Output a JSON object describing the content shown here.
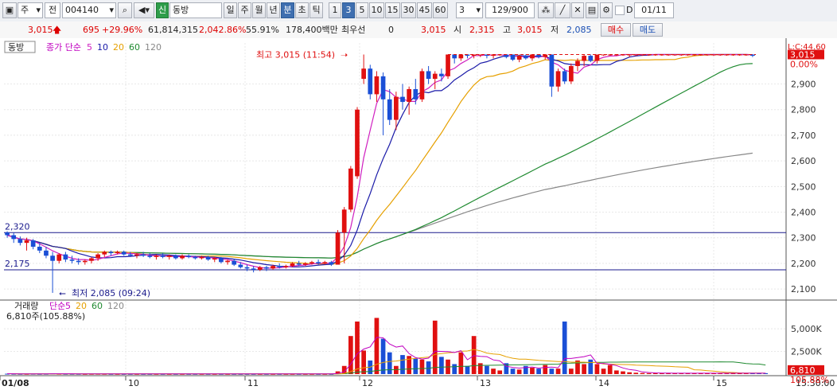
{
  "toolbar": {
    "type_select": "주",
    "type_select2": "전",
    "code": "004140",
    "stock_badge": "신",
    "stock_name": "동방",
    "periods": [
      "일",
      "주",
      "월",
      "년",
      "분",
      "초",
      "틱"
    ],
    "active_period": "분",
    "minutes": [
      "1",
      "3",
      "5",
      "10",
      "15",
      "30",
      "45",
      "60"
    ],
    "active_minute": "3",
    "interval_value": "3",
    "count": "129/900",
    "date_checkbox": "D",
    "date": "01/11"
  },
  "quote": {
    "price": "3,015",
    "change": "695",
    "change_pct": "+29.96%",
    "volume": "61,814,315",
    "vol_ratio": "2,042.86%",
    "turnover": "55.91%",
    "amount": "178,400백만",
    "pref_label": "최우선",
    "pref_value": "0",
    "ask": "3,015",
    "open_label": "시",
    "open": "2,315",
    "high_label": "고",
    "high": "3,015",
    "low_label": "저",
    "low": "2,085",
    "buy_label": "매수",
    "sell_label": "매도"
  },
  "price_panel": {
    "stock_label": "동방",
    "legend": [
      {
        "label": "종가 단순",
        "color": "#c000c0"
      },
      {
        "label": "5",
        "color": "#d020c0"
      },
      {
        "label": "10",
        "color": "#1a1aa8"
      },
      {
        "label": "20",
        "color": "#e6a000"
      },
      {
        "label": "60",
        "color": "#1f8a30"
      },
      {
        "label": "120",
        "color": "#888888"
      }
    ],
    "high_annotation": "최고 3,015 (11:54)",
    "low_annotation": "최저 2,085 (09:24)",
    "line1_label": "2,320",
    "line2_label": "2,175",
    "axis_top_label": "L:C:44.60",
    "price_badge": "3,015",
    "pct_badge": "0.00%",
    "y_ticks": [
      "2,900",
      "2,800",
      "2,700",
      "2,600",
      "2,500",
      "2,400",
      "2,300",
      "2,200",
      "2,100"
    ]
  },
  "volume_panel": {
    "title": "거래량",
    "legend": [
      {
        "label": "단순",
        "color": "#c000c0"
      },
      {
        "label": "5",
        "color": "#c000c0"
      },
      {
        "label": "20",
        "color": "#e6a000"
      },
      {
        "label": "60",
        "color": "#1f8a30"
      },
      {
        "label": "120",
        "color": "#888888"
      }
    ],
    "current": "6,810주(105.88%)",
    "y_ticks": [
      "5,000K",
      "2,500K"
    ],
    "vol_badge": "6,810",
    "vol_pct": "105.88%"
  },
  "x_axis": {
    "labels": [
      "01/08",
      "10",
      "11",
      "12",
      "13",
      "14",
      "15"
    ],
    "time": "15:30:00"
  },
  "chart_data": {
    "type": "candlestick",
    "y_range": [
      2060,
      3060
    ],
    "candles": [
      {
        "o": 2320,
        "h": 2325,
        "l": 2300,
        "c": 2310
      },
      {
        "o": 2310,
        "h": 2320,
        "l": 2280,
        "c": 2295
      },
      {
        "o": 2295,
        "h": 2305,
        "l": 2270,
        "c": 2280
      },
      {
        "o": 2280,
        "h": 2300,
        "l": 2250,
        "c": 2290
      },
      {
        "o": 2290,
        "h": 2295,
        "l": 2255,
        "c": 2265
      },
      {
        "o": 2265,
        "h": 2280,
        "l": 2240,
        "c": 2250
      },
      {
        "o": 2250,
        "h": 2265,
        "l": 2220,
        "c": 2230
      },
      {
        "o": 2230,
        "h": 2245,
        "l": 2085,
        "c": 2210
      },
      {
        "o": 2210,
        "h": 2240,
        "l": 2200,
        "c": 2235
      },
      {
        "o": 2235,
        "h": 2245,
        "l": 2205,
        "c": 2215
      },
      {
        "o": 2215,
        "h": 2230,
        "l": 2200,
        "c": 2210
      },
      {
        "o": 2210,
        "h": 2220,
        "l": 2195,
        "c": 2205
      },
      {
        "o": 2205,
        "h": 2215,
        "l": 2195,
        "c": 2210
      },
      {
        "o": 2210,
        "h": 2225,
        "l": 2200,
        "c": 2220
      },
      {
        "o": 2220,
        "h": 2240,
        "l": 2210,
        "c": 2235
      },
      {
        "o": 2235,
        "h": 2250,
        "l": 2225,
        "c": 2245
      },
      {
        "o": 2245,
        "h": 2250,
        "l": 2230,
        "c": 2240
      },
      {
        "o": 2240,
        "h": 2250,
        "l": 2235,
        "c": 2245
      },
      {
        "o": 2245,
        "h": 2250,
        "l": 2230,
        "c": 2235
      },
      {
        "o": 2235,
        "h": 2245,
        "l": 2225,
        "c": 2230
      },
      {
        "o": 2230,
        "h": 2240,
        "l": 2220,
        "c": 2235
      },
      {
        "o": 2235,
        "h": 2245,
        "l": 2225,
        "c": 2230
      },
      {
        "o": 2230,
        "h": 2240,
        "l": 2220,
        "c": 2225
      },
      {
        "o": 2225,
        "h": 2235,
        "l": 2215,
        "c": 2230
      },
      {
        "o": 2230,
        "h": 2240,
        "l": 2220,
        "c": 2225
      },
      {
        "o": 2225,
        "h": 2235,
        "l": 2215,
        "c": 2230
      },
      {
        "o": 2230,
        "h": 2235,
        "l": 2215,
        "c": 2220
      },
      {
        "o": 2220,
        "h": 2235,
        "l": 2215,
        "c": 2230
      },
      {
        "o": 2230,
        "h": 2235,
        "l": 2220,
        "c": 2225
      },
      {
        "o": 2225,
        "h": 2230,
        "l": 2215,
        "c": 2220
      },
      {
        "o": 2220,
        "h": 2230,
        "l": 2215,
        "c": 2225
      },
      {
        "o": 2225,
        "h": 2230,
        "l": 2210,
        "c": 2215
      },
      {
        "o": 2215,
        "h": 2225,
        "l": 2205,
        "c": 2220
      },
      {
        "o": 2220,
        "h": 2225,
        "l": 2200,
        "c": 2205
      },
      {
        "o": 2205,
        "h": 2215,
        "l": 2195,
        "c": 2210
      },
      {
        "o": 2210,
        "h": 2215,
        "l": 2190,
        "c": 2195
      },
      {
        "o": 2195,
        "h": 2205,
        "l": 2180,
        "c": 2185
      },
      {
        "o": 2185,
        "h": 2195,
        "l": 2170,
        "c": 2180
      },
      {
        "o": 2180,
        "h": 2190,
        "l": 2165,
        "c": 2175
      },
      {
        "o": 2175,
        "h": 2190,
        "l": 2170,
        "c": 2185
      },
      {
        "o": 2185,
        "h": 2190,
        "l": 2170,
        "c": 2180
      },
      {
        "o": 2180,
        "h": 2195,
        "l": 2175,
        "c": 2190
      },
      {
        "o": 2190,
        "h": 2200,
        "l": 2180,
        "c": 2185
      },
      {
        "o": 2185,
        "h": 2195,
        "l": 2180,
        "c": 2190
      },
      {
        "o": 2190,
        "h": 2205,
        "l": 2185,
        "c": 2200
      },
      {
        "o": 2200,
        "h": 2210,
        "l": 2190,
        "c": 2195
      },
      {
        "o": 2195,
        "h": 2205,
        "l": 2190,
        "c": 2200
      },
      {
        "o": 2200,
        "h": 2210,
        "l": 2195,
        "c": 2205
      },
      {
        "o": 2205,
        "h": 2215,
        "l": 2195,
        "c": 2200
      },
      {
        "o": 2200,
        "h": 2210,
        "l": 2195,
        "c": 2205
      },
      {
        "o": 2205,
        "h": 2210,
        "l": 2190,
        "c": 2195
      },
      {
        "o": 2195,
        "h": 2330,
        "l": 2195,
        "c": 2320
      },
      {
        "o": 2320,
        "h": 2420,
        "l": 2200,
        "c": 2410
      },
      {
        "o": 2410,
        "h": 2580,
        "l": 2400,
        "c": 2570
      },
      {
        "o": 2540,
        "h": 2810,
        "l": 2530,
        "c": 2800
      },
      {
        "o": 2920,
        "h": 3015,
        "l": 2900,
        "c": 2960
      },
      {
        "o": 2960,
        "h": 2975,
        "l": 2840,
        "c": 2860
      },
      {
        "o": 2860,
        "h": 2950,
        "l": 2830,
        "c": 2930
      },
      {
        "o": 2930,
        "h": 2945,
        "l": 2700,
        "c": 2840
      },
      {
        "o": 2840,
        "h": 2880,
        "l": 2740,
        "c": 2760
      },
      {
        "o": 2760,
        "h": 2870,
        "l": 2720,
        "c": 2850
      },
      {
        "o": 2850,
        "h": 2900,
        "l": 2800,
        "c": 2830
      },
      {
        "o": 2830,
        "h": 2890,
        "l": 2780,
        "c": 2880
      },
      {
        "o": 2880,
        "h": 2920,
        "l": 2820,
        "c": 2840
      },
      {
        "o": 2840,
        "h": 2960,
        "l": 2830,
        "c": 2950
      },
      {
        "o": 2950,
        "h": 2970,
        "l": 2900,
        "c": 2920
      },
      {
        "o": 2920,
        "h": 2950,
        "l": 2880,
        "c": 2940
      },
      {
        "o": 2940,
        "h": 2960,
        "l": 2910,
        "c": 2930
      },
      {
        "o": 2930,
        "h": 3015,
        "l": 2920,
        "c": 3015
      },
      {
        "o": 3015,
        "h": 3015,
        "l": 2980,
        "c": 3000
      },
      {
        "o": 3000,
        "h": 3015,
        "l": 2990,
        "c": 3015
      },
      {
        "o": 3015,
        "h": 3015,
        "l": 3000,
        "c": 3010
      },
      {
        "o": 3010,
        "h": 3015,
        "l": 3000,
        "c": 3015
      },
      {
        "o": 3015,
        "h": 3015,
        "l": 3005,
        "c": 3015
      },
      {
        "o": 3015,
        "h": 3015,
        "l": 3000,
        "c": 3010
      },
      {
        "o": 3010,
        "h": 3015,
        "l": 3000,
        "c": 3015
      },
      {
        "o": 3015,
        "h": 3015,
        "l": 3010,
        "c": 3015
      },
      {
        "o": 3015,
        "h": 3015,
        "l": 3000,
        "c": 3005
      },
      {
        "o": 3015,
        "h": 3015,
        "l": 2990,
        "c": 2995
      },
      {
        "o": 2995,
        "h": 3015,
        "l": 2985,
        "c": 3010
      },
      {
        "o": 3010,
        "h": 3015,
        "l": 2995,
        "c": 3000
      },
      {
        "o": 3000,
        "h": 3015,
        "l": 2990,
        "c": 3015
      },
      {
        "o": 3015,
        "h": 3015,
        "l": 3000,
        "c": 3005
      },
      {
        "o": 3005,
        "h": 3015,
        "l": 2995,
        "c": 3015
      },
      {
        "o": 3015,
        "h": 3015,
        "l": 2850,
        "c": 2890
      },
      {
        "o": 2890,
        "h": 2960,
        "l": 2870,
        "c": 2950
      },
      {
        "o": 2950,
        "h": 2960,
        "l": 2900,
        "c": 2910
      },
      {
        "o": 2910,
        "h": 2980,
        "l": 2900,
        "c": 2970
      },
      {
        "o": 2970,
        "h": 3000,
        "l": 2950,
        "c": 2990
      },
      {
        "o": 2990,
        "h": 3015,
        "l": 2970,
        "c": 3010
      },
      {
        "o": 3010,
        "h": 3015,
        "l": 2985,
        "c": 2990
      },
      {
        "o": 2990,
        "h": 3015,
        "l": 2980,
        "c": 3015
      },
      {
        "o": 3015,
        "h": 3015,
        "l": 3010,
        "c": 3015
      },
      {
        "o": 3015,
        "h": 3015,
        "l": 3010,
        "c": 3015
      },
      {
        "o": 3015,
        "h": 3015,
        "l": 3010,
        "c": 3015
      },
      {
        "o": 3015,
        "h": 3015,
        "l": 3010,
        "c": 3015
      },
      {
        "o": 3015,
        "h": 3015,
        "l": 3005,
        "c": 3015
      },
      {
        "o": 3015,
        "h": 3015,
        "l": 3010,
        "c": 3015
      },
      {
        "o": 3015,
        "h": 3015,
        "l": 3010,
        "c": 3015
      },
      {
        "o": 3015,
        "h": 3015,
        "l": 3010,
        "c": 3015
      },
      {
        "o": 3015,
        "h": 3015,
        "l": 3010,
        "c": 3015
      },
      {
        "o": 3015,
        "h": 3015,
        "l": 3010,
        "c": 3015
      },
      {
        "o": 3015,
        "h": 3015,
        "l": 3010,
        "c": 3015
      },
      {
        "o": 3015,
        "h": 3015,
        "l": 3010,
        "c": 3015
      },
      {
        "o": 3015,
        "h": 3015,
        "l": 3010,
        "c": 3015
      },
      {
        "o": 3015,
        "h": 3015,
        "l": 3010,
        "c": 3015
      },
      {
        "o": 3015,
        "h": 3015,
        "l": 3010,
        "c": 3015
      },
      {
        "o": 3015,
        "h": 3015,
        "l": 3010,
        "c": 3015
      },
      {
        "o": 3015,
        "h": 3015,
        "l": 3010,
        "c": 3015
      },
      {
        "o": 3015,
        "h": 3015,
        "l": 3010,
        "c": 3015
      },
      {
        "o": 3015,
        "h": 3015,
        "l": 3010,
        "c": 3015
      },
      {
        "o": 3015,
        "h": 3015,
        "l": 3010,
        "c": 3015
      },
      {
        "o": 3015,
        "h": 3015,
        "l": 3010,
        "c": 3015
      },
      {
        "o": 3015,
        "h": 3015,
        "l": 3010,
        "c": 3015
      },
      {
        "o": 3015,
        "h": 3015,
        "l": 3010,
        "c": 3015
      },
      {
        "o": 3015,
        "h": 3015,
        "l": 3005,
        "c": 3010
      }
    ],
    "hlines": [
      2320,
      2175
    ],
    "volume_k": [
      40,
      30,
      20,
      20,
      30,
      20,
      25,
      60,
      30,
      20,
      20,
      20,
      15,
      20,
      25,
      20,
      15,
      15,
      15,
      15,
      15,
      15,
      15,
      15,
      15,
      15,
      15,
      15,
      15,
      15,
      15,
      15,
      15,
      15,
      15,
      15,
      15,
      15,
      15,
      15,
      15,
      15,
      15,
      15,
      15,
      15,
      15,
      15,
      15,
      15,
      15,
      300,
      900,
      4200,
      5800,
      2600,
      1500,
      6200,
      3900,
      2400,
      900,
      2100,
      2000,
      1700,
      1600,
      1400,
      5900,
      1900,
      1600,
      1100,
      2400,
      900,
      4200,
      1200,
      900,
      600,
      400,
      1200,
      600,
      500,
      900,
      700,
      600,
      1000,
      600,
      600,
      5800,
      600,
      1500,
      1100,
      1600,
      1100,
      600,
      1000,
      400,
      300,
      200,
      150,
      120,
      100,
      100,
      100,
      100,
      100,
      100,
      100,
      100,
      100,
      100,
      100,
      100,
      100,
      100,
      100,
      100,
      100,
      100,
      100
    ]
  }
}
